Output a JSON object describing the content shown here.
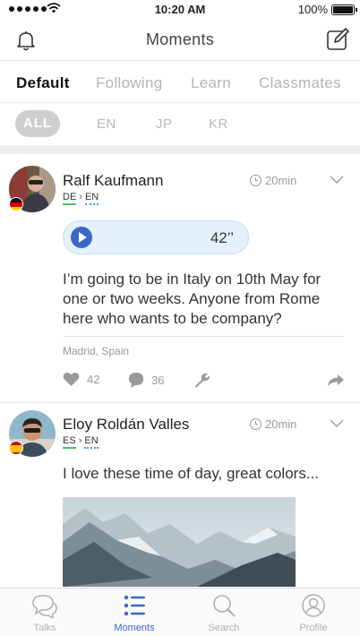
{
  "status_bar": {
    "time": "10:20 AM",
    "battery": "100%"
  },
  "header": {
    "title": "Moments"
  },
  "tabs": [
    {
      "label": "Default",
      "active": true
    },
    {
      "label": "Following",
      "active": false
    },
    {
      "label": "Learn",
      "active": false
    },
    {
      "label": "Classmates",
      "active": false
    }
  ],
  "filters": {
    "all": "ALL",
    "en": "EN",
    "jp": "JP",
    "kr": "KR"
  },
  "posts": [
    {
      "name": "Ralf Kaufmann",
      "from_lang": "DE",
      "to_lang": "EN",
      "time_ago": "20min",
      "audio_duration": "42’’",
      "text": "I’m going to be in Italy on 10th May for one or two weeks. Anyone from Rome here who wants to be company?",
      "location": "Madrid, Spain",
      "likes": "42",
      "comments": "36",
      "flag": "germany-flag-icon"
    },
    {
      "name": "Eloy Roldán Valles",
      "from_lang": "ES",
      "to_lang": "EN",
      "time_ago": "20min",
      "text": "I love these time of day, great colors...",
      "flag": "spain-flag-icon"
    }
  ],
  "bottom_tabs": [
    {
      "label": "Talks",
      "icon": "chat-bubbles-icon"
    },
    {
      "label": "Moments",
      "icon": "moments-list-icon",
      "active": true
    },
    {
      "label": "Search",
      "icon": "search-icon"
    },
    {
      "label": "Profile",
      "icon": "profile-icon"
    }
  ],
  "colors": {
    "accent": "#3d66c9",
    "native_underline": "#47c35f",
    "learning_underline": "#4a9ce8"
  }
}
